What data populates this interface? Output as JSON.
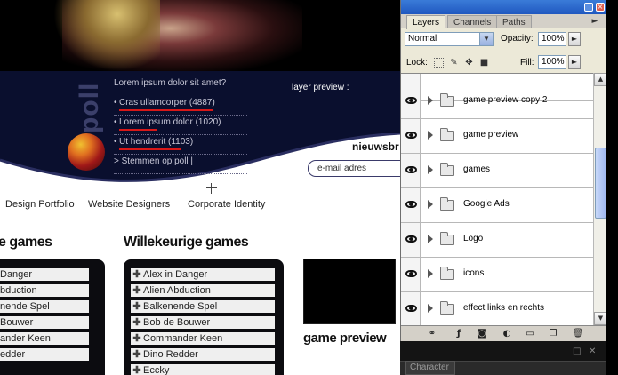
{
  "website": {
    "poll": {
      "word": "poll",
      "question": "Lorem ipsum dolor sit amet?",
      "options": [
        "Cras ullamcorper (4887)",
        "Lorem ipsum dolor (1020)",
        "Ut hendrerit (1103)"
      ],
      "vote_link": "> Stemmen op poll |"
    },
    "layer_preview_label": "layer preview :",
    "newsletter_heading": "nieuwsbr",
    "email_placeholder": "e-mail adres",
    "nav": [
      "Design Portfolio",
      "Website Designers",
      "Corporate Identity"
    ],
    "left_section_title": "e games",
    "left_games": [
      "Danger",
      "bduction",
      "nende Spel",
      "Bouwer",
      "ander Keen",
      "edder"
    ],
    "random_games_title": "Willekeurige games",
    "random_games": [
      "Alex in Danger",
      "Alien Abduction",
      "Balkenende Spel",
      "Bob de Bouwer",
      "Commander Keen",
      "Dino Redder",
      "Eccky"
    ],
    "game_preview_label": "game preview"
  },
  "layers_panel": {
    "tabs": [
      "Layers",
      "Channels",
      "Paths"
    ],
    "active_tab": "Layers",
    "blend_mode": "Normal",
    "opacity_label": "Opacity:",
    "opacity_value": "100%",
    "lock_label": "Lock:",
    "fill_label": "Fill:",
    "fill_value": "100%",
    "layers": [
      {
        "name": "game preview copy 2",
        "visible": true
      },
      {
        "name": "game preview",
        "visible": true
      },
      {
        "name": "games",
        "visible": true
      },
      {
        "name": "Google Ads",
        "visible": true
      },
      {
        "name": "Logo",
        "visible": true
      },
      {
        "name": "icons",
        "visible": true
      },
      {
        "name": "effect links en rechts",
        "visible": true
      }
    ],
    "bottom_icons": [
      "link-layers-icon",
      "layer-style-icon",
      "add-mask-icon",
      "adjustment-layer-icon",
      "new-group-icon",
      "new-layer-icon",
      "delete-layer-icon"
    ]
  },
  "character_panel": {
    "tab_label": "Character"
  },
  "colors": {
    "accent_red": "#d81818",
    "dark_blue": "#0a0f2e",
    "titlebar_blue": "#2058c0"
  }
}
